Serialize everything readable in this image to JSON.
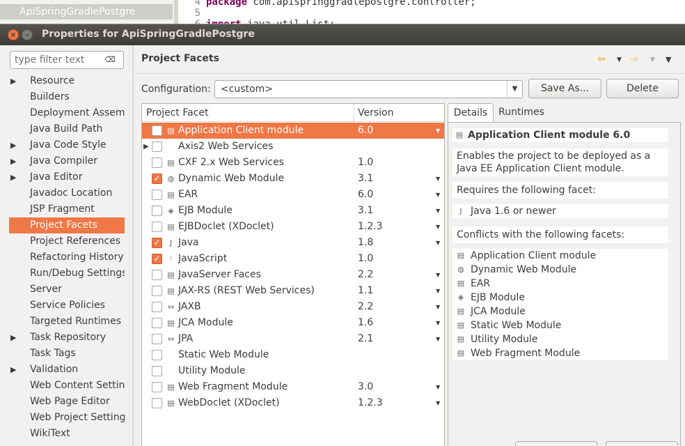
{
  "background": {
    "project_row": "ApiSpringGradlePostgre",
    "code_lines": [
      {
        "num": "4",
        "keyword": "package",
        "text": " com.apispringgradlepostgre.controller;"
      },
      {
        "num": "5",
        "keyword": "",
        "text": ""
      },
      {
        "num": "6",
        "keyword": "import",
        "text": " java.util.List;"
      }
    ]
  },
  "dialog": {
    "title": "Properties for ApiSpringGradlePostgre",
    "filter_placeholder": "type filter text",
    "nav_items": [
      {
        "label": "Resource",
        "expandable": true
      },
      {
        "label": "Builders",
        "expandable": false
      },
      {
        "label": "Deployment Assemb",
        "expandable": false
      },
      {
        "label": "Java Build Path",
        "expandable": false
      },
      {
        "label": "Java Code Style",
        "expandable": true
      },
      {
        "label": "Java Compiler",
        "expandable": true
      },
      {
        "label": "Java Editor",
        "expandable": true
      },
      {
        "label": "Javadoc Location",
        "expandable": false
      },
      {
        "label": "JSP Fragment",
        "expandable": false
      },
      {
        "label": "Project Facets",
        "expandable": false,
        "selected": true
      },
      {
        "label": "Project References",
        "expandable": false
      },
      {
        "label": "Refactoring History",
        "expandable": false
      },
      {
        "label": "Run/Debug Settings",
        "expandable": false
      },
      {
        "label": "Server",
        "expandable": false
      },
      {
        "label": "Service Policies",
        "expandable": false
      },
      {
        "label": "Targeted Runtimes",
        "expandable": false
      },
      {
        "label": "Task Repository",
        "expandable": true
      },
      {
        "label": "Task Tags",
        "expandable": false
      },
      {
        "label": "Validation",
        "expandable": true
      },
      {
        "label": "Web Content Setting",
        "expandable": false
      },
      {
        "label": "Web Page Editor",
        "expandable": false
      },
      {
        "label": "Web Project Setting",
        "expandable": false
      },
      {
        "label": "WikiText",
        "expandable": false
      }
    ],
    "page_title": "Project Facets",
    "configuration_label": "Configuration:",
    "configuration_value": "<custom>",
    "save_as_label": "Save As...",
    "delete_label": "Delete",
    "facets_header": {
      "facet": "Project Facet",
      "version": "Version"
    },
    "facets": [
      {
        "name": "Application Client module",
        "version": "6.0",
        "checked": false,
        "selected": true,
        "dropdown": true,
        "icon": "document-icon"
      },
      {
        "name": "Axis2 Web Services",
        "version": "",
        "checked": false,
        "expandable": true,
        "dropdown": false,
        "icon": ""
      },
      {
        "name": "CXF 2.x Web Services",
        "version": "1.0",
        "checked": false,
        "dropdown": false,
        "icon": "document-icon"
      },
      {
        "name": "Dynamic Web Module",
        "version": "3.1",
        "checked": true,
        "dropdown": true,
        "icon": "globe-icon"
      },
      {
        "name": "EAR",
        "version": "6.0",
        "checked": false,
        "dropdown": true,
        "icon": "document-icon"
      },
      {
        "name": "EJB Module",
        "version": "3.1",
        "checked": false,
        "dropdown": true,
        "icon": "bean-icon"
      },
      {
        "name": "EJBDoclet (XDoclet)",
        "version": "1.2.3",
        "checked": false,
        "dropdown": true,
        "icon": "document-icon"
      },
      {
        "name": "Java",
        "version": "1.8",
        "checked": true,
        "dropdown": true,
        "icon": "java-icon"
      },
      {
        "name": "JavaScript",
        "version": "1.0",
        "checked": true,
        "dropdown": false,
        "icon": "javascript-icon"
      },
      {
        "name": "JavaServer Faces",
        "version": "2.2",
        "checked": false,
        "dropdown": true,
        "icon": "document-icon"
      },
      {
        "name": "JAX-RS (REST Web Services)",
        "version": "1.1",
        "checked": false,
        "dropdown": true,
        "icon": "document-icon"
      },
      {
        "name": "JAXB",
        "version": "2.2",
        "checked": false,
        "dropdown": true,
        "icon": "jaxb-icon"
      },
      {
        "name": "JCA Module",
        "version": "1.6",
        "checked": false,
        "dropdown": true,
        "icon": "document-icon"
      },
      {
        "name": "JPA",
        "version": "2.1",
        "checked": false,
        "dropdown": true,
        "icon": "jpa-icon"
      },
      {
        "name": "Static Web Module",
        "version": "",
        "checked": false,
        "dropdown": false,
        "icon": ""
      },
      {
        "name": "Utility Module",
        "version": "",
        "checked": false,
        "dropdown": false,
        "icon": ""
      },
      {
        "name": "Web Fragment Module",
        "version": "3.0",
        "checked": false,
        "dropdown": true,
        "icon": "document-icon"
      },
      {
        "name": "WebDoclet (XDoclet)",
        "version": "1.2.3",
        "checked": false,
        "dropdown": true,
        "icon": "document-icon"
      }
    ],
    "tabs": {
      "details": "Details",
      "runtimes": "Runtimes"
    },
    "details": {
      "title": "Application Client module 6.0",
      "description": "Enables the project to be deployed as a Java EE Application Client module.",
      "requires_heading": "Requires the following facet:",
      "requires": "Java 1.6 or newer",
      "conflicts_heading": "Conflicts with the following facets:",
      "conflicts": [
        {
          "label": "Application Client module",
          "icon": "document-icon"
        },
        {
          "label": "Dynamic Web Module",
          "icon": "globe-icon"
        },
        {
          "label": "EAR",
          "icon": "document-icon"
        },
        {
          "label": "EJB Module",
          "icon": "bean-icon"
        },
        {
          "label": "JCA Module",
          "icon": "document-icon"
        },
        {
          "label": "Static Web Module",
          "icon": "document-icon"
        },
        {
          "label": "Utility Module",
          "icon": "document-icon"
        },
        {
          "label": "Web Fragment Module",
          "icon": "document-icon"
        }
      ]
    }
  },
  "colors": {
    "accent": "#f07746",
    "titlebar": "#3c3b37",
    "dialog_bg": "#f2f1f0"
  }
}
